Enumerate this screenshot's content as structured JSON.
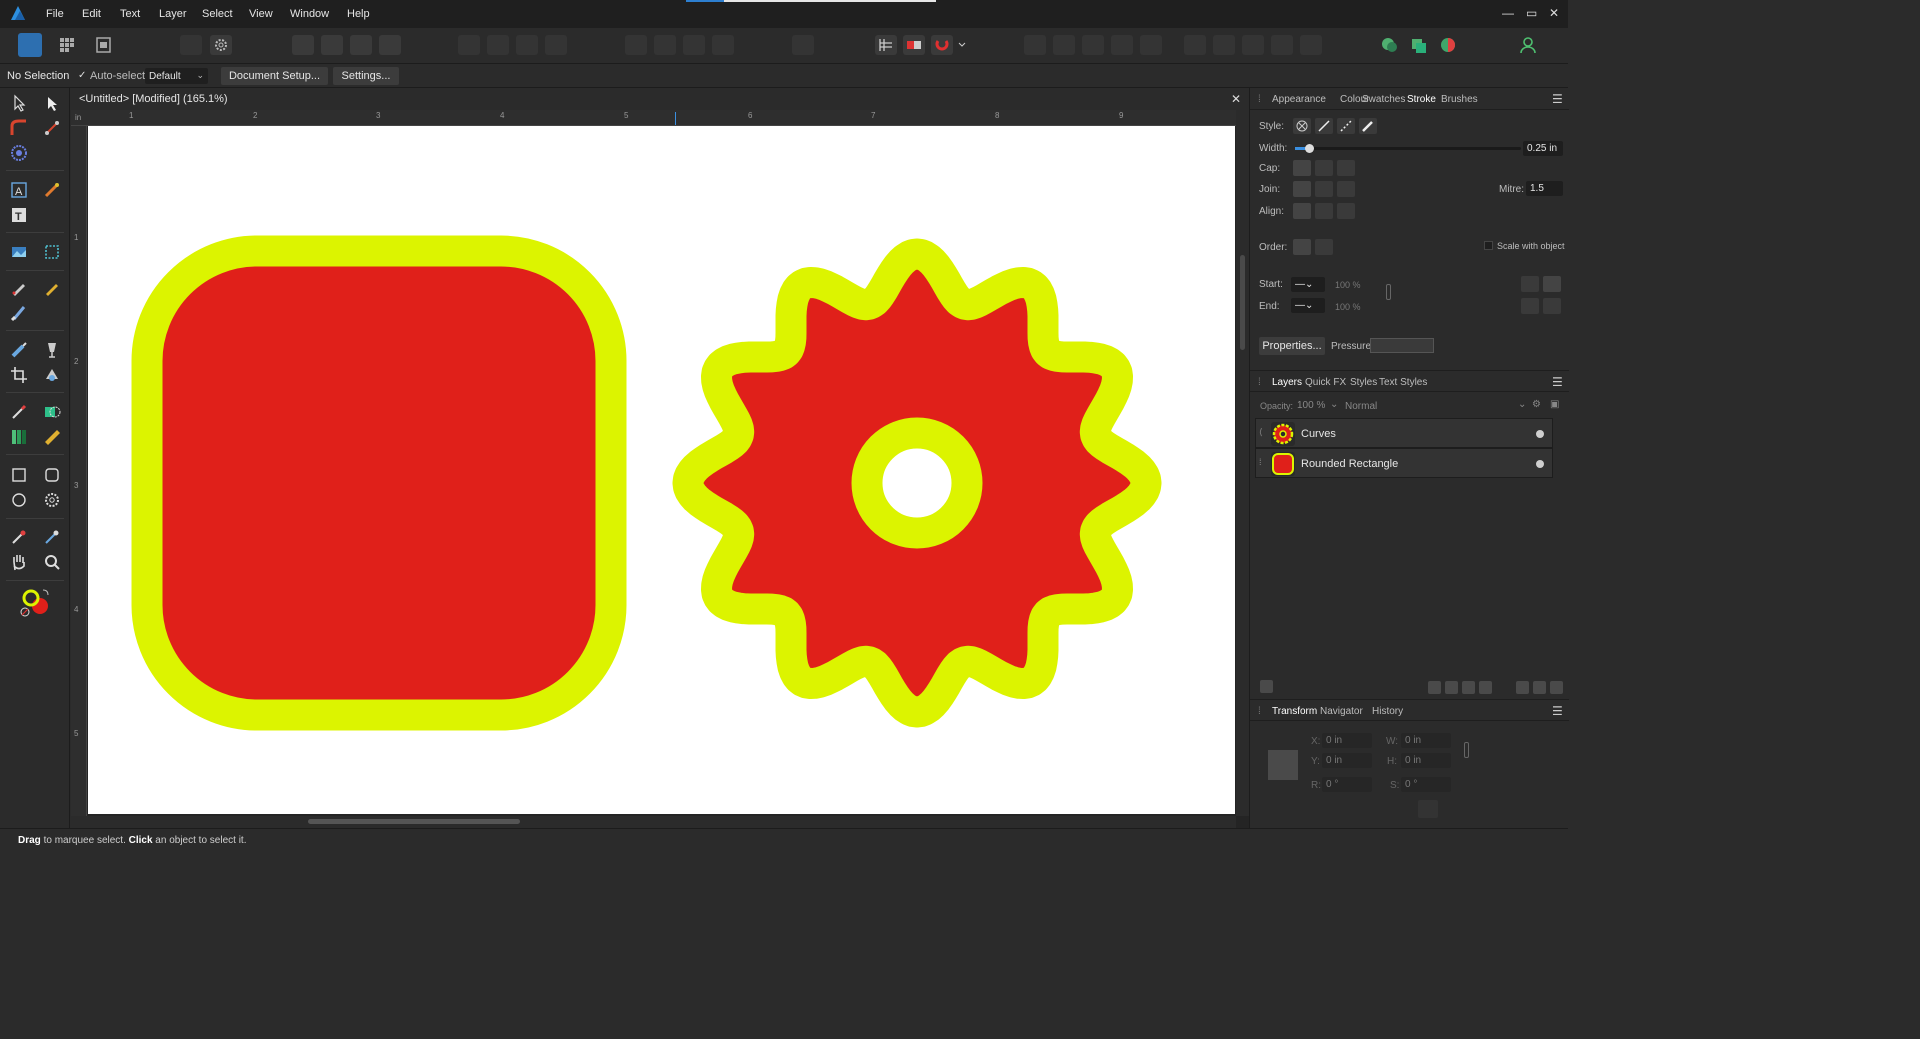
{
  "menubar": {
    "items": [
      "File",
      "Edit",
      "Text",
      "Layer",
      "Select",
      "View",
      "Window",
      "Help"
    ],
    "window_controls": [
      "—",
      "▭",
      "✕"
    ]
  },
  "context": {
    "selection": "No Selection",
    "auto_select_label": "Auto-select:",
    "auto_select_checked": true,
    "auto_select_value": "Default",
    "document_setup": "Document Setup...",
    "settings": "Settings..."
  },
  "document": {
    "tab_title": "<Untitled> [Modified] (165.1%)",
    "close": "✕",
    "ruler_unit": "in",
    "ruler_h_numbers": [
      "1",
      "2",
      "3",
      "4",
      "5",
      "6",
      "7",
      "8",
      "9"
    ],
    "ruler_v_numbers": [
      "1",
      "2",
      "3",
      "4",
      "5"
    ],
    "colors": {
      "fill": "#e0201a",
      "stroke": "#dcf400"
    }
  },
  "status": {
    "b1": "Drag",
    "t1": " to marquee select. ",
    "b2": "Click",
    "t2": " an object to select it."
  },
  "stroke_panel": {
    "tabs": [
      "Appearance",
      "Colour",
      "Swatches",
      "Stroke",
      "Brushes"
    ],
    "active_tab": "Stroke",
    "style_label": "Style:",
    "width_label": "Width:",
    "width_value": "0.25 in",
    "cap_label": "Cap:",
    "join_label": "Join:",
    "mitre_label": "Mitre:",
    "mitre_value": "1.5",
    "align_label": "Align:",
    "order_label": "Order:",
    "scale_with_object": "Scale with object",
    "start_label": "Start:",
    "end_label": "End:",
    "start_pct": "100 %",
    "end_pct": "100 %",
    "properties_button": "Properties...",
    "pressure_label": "Pressure:"
  },
  "layers_panel": {
    "tabs": [
      "Layers",
      "Quick FX",
      "Styles",
      "Text Styles"
    ],
    "active_tab": "Layers",
    "opacity_label": "Opacity:",
    "opacity_value": "100 %",
    "blend_mode": "Normal",
    "layers": [
      {
        "name": "Curves"
      },
      {
        "name": "Rounded Rectangle"
      }
    ]
  },
  "transform_panel": {
    "tabs": [
      "Transform",
      "Navigator",
      "History"
    ],
    "active_tab": "Transform",
    "x_label": "X:",
    "x_value": "0 in",
    "y_label": "Y:",
    "y_value": "0 in",
    "w_label": "W:",
    "w_value": "0 in",
    "h_label": "H:",
    "h_value": "0 in",
    "r_label": "R:",
    "r_value": "0 °",
    "s_label": "S:",
    "s_value": "0 °"
  }
}
